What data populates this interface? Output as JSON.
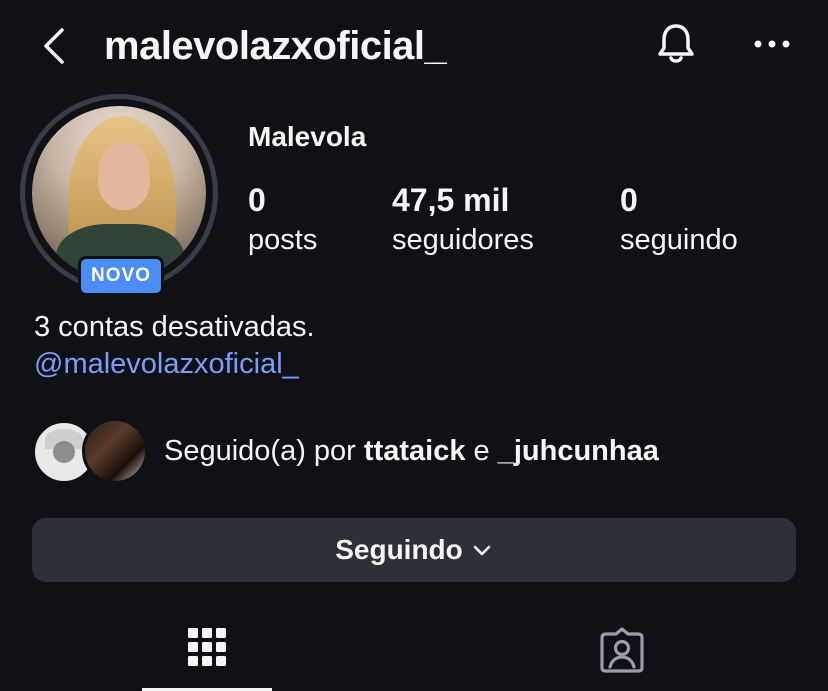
{
  "header": {
    "username": "malevolazxoficial_",
    "back_icon": "chevron-left-icon",
    "bell_icon": "bell-icon",
    "more_icon": "more-horizontal-icon"
  },
  "profile": {
    "avatar_badge": "NOVO",
    "display_name": "Malevola",
    "stats": [
      {
        "value": "0",
        "label": "posts"
      },
      {
        "value": "47,5 mil",
        "label": "seguidores"
      },
      {
        "value": "0",
        "label": "seguindo"
      }
    ],
    "bio": "3 contas desativadas.",
    "bio_link": "@malevolazxoficial_"
  },
  "followed_by": {
    "prefix": "Seguido(a) por",
    "user1": "ttataick",
    "conjunction": "e",
    "user2": "_juhcunhaa"
  },
  "actions": {
    "following_label": "Seguindo"
  },
  "tabs": [
    {
      "icon": "grid-icon",
      "selected": true
    },
    {
      "icon": "tagged-person-icon",
      "selected": false
    }
  ],
  "colors": {
    "background": "#0f1116",
    "badge": "#4c8cf5",
    "link": "#7e9cf5",
    "button": "#2d3036"
  }
}
